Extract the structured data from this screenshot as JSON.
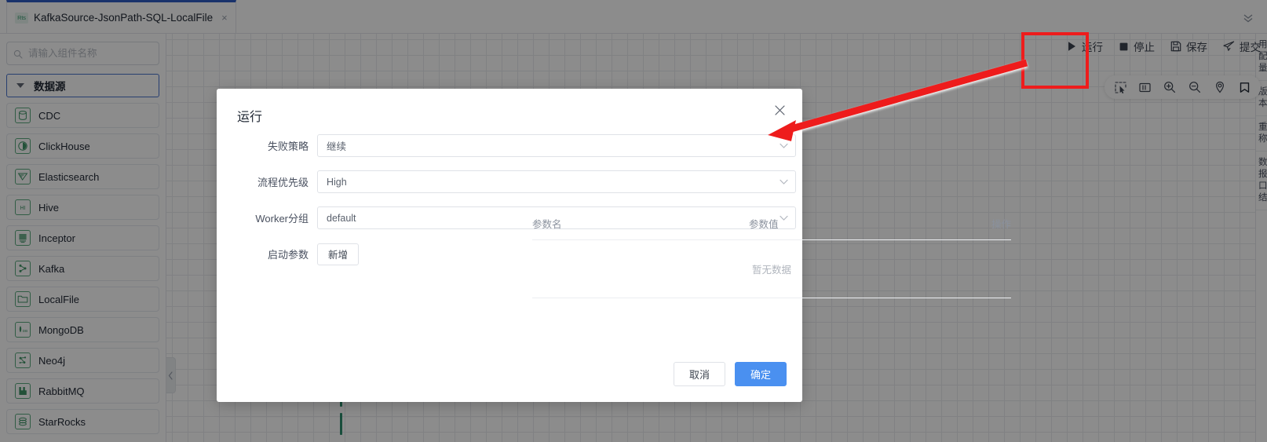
{
  "tab": {
    "badge": "Rts",
    "title": "KafkaSource-JsonPath-SQL-LocalFile",
    "close_label": "×",
    "collapse_icon": "double-chevron-down-icon"
  },
  "sidebar": {
    "search": {
      "placeholder": "请输入组件名称",
      "value": "",
      "icon": "search-icon"
    },
    "group": {
      "label": "数据源",
      "expanded": true,
      "caret": "caret-down-icon"
    },
    "items": [
      {
        "label": "CDC",
        "icon": "cdc-icon"
      },
      {
        "label": "ClickHouse",
        "icon": "clickhouse-icon"
      },
      {
        "label": "Elasticsearch",
        "icon": "elasticsearch-icon"
      },
      {
        "label": "Hive",
        "icon": "hive-icon"
      },
      {
        "label": "Inceptor",
        "icon": "inceptor-icon"
      },
      {
        "label": "Kafka",
        "icon": "kafka-icon"
      },
      {
        "label": "LocalFile",
        "icon": "localfile-icon"
      },
      {
        "label": "MongoDB",
        "icon": "mongodb-icon"
      },
      {
        "label": "Neo4j",
        "icon": "neo4j-icon"
      },
      {
        "label": "RabbitMQ",
        "icon": "rabbitmq-icon"
      },
      {
        "label": "StarRocks",
        "icon": "starrocks-icon"
      }
    ]
  },
  "actionbar": {
    "items": [
      {
        "label": "运行",
        "icon": "play-icon"
      },
      {
        "label": "停止",
        "icon": "stop-icon"
      },
      {
        "label": "保存",
        "icon": "save-icon"
      },
      {
        "label": "提交",
        "icon": "submit-icon"
      }
    ]
  },
  "toolstrip": {
    "items": [
      {
        "icon": "marquee-select-icon"
      },
      {
        "icon": "fit-to-screen-icon"
      },
      {
        "icon": "zoom-in-icon"
      },
      {
        "icon": "zoom-out-icon"
      },
      {
        "icon": "locate-icon"
      },
      {
        "icon": "bookmark-icon"
      }
    ]
  },
  "canvas": {
    "collapse_handle_icon": "chevron-left-icon"
  },
  "right_panel": {
    "lines": [
      "用",
      "配",
      "量",
      "版",
      "本",
      "重",
      "称",
      "数",
      "报",
      "口",
      "结"
    ]
  },
  "modal": {
    "title": "运行",
    "close_icon": "close-icon",
    "fields": [
      {
        "label": "失败策略",
        "value": "继续",
        "icon": "chevron-down-icon"
      },
      {
        "label": "流程优先级",
        "value": "High",
        "icon": "chevron-down-icon"
      },
      {
        "label": "Worker分组",
        "value": "default",
        "icon": "chevron-down-icon"
      }
    ],
    "params": {
      "label": "启动参数",
      "add_button": "新增",
      "columns": [
        "参数名",
        "参数值",
        "操作"
      ],
      "rows": [],
      "empty_text": "暂无数据"
    },
    "footer": {
      "cancel": "取消",
      "confirm": "确定"
    }
  },
  "annotations": {
    "highlight_color": "#ee1c1c",
    "box_target": "运行",
    "arrow_target": "失败策略"
  }
}
